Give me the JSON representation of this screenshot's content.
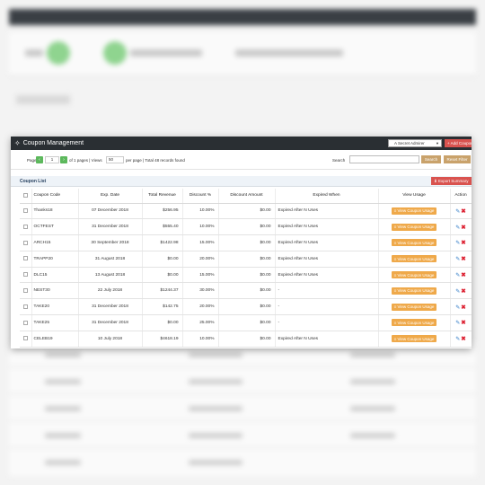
{
  "window": {
    "title": "Coupon Management",
    "admin_select": "A Secret Admirer",
    "add_button": "+ Add Coupon"
  },
  "pager": {
    "page_label": "Page",
    "current_page": "1",
    "of_pages_text": "of 1 pages | Views",
    "per_page_value": "50",
    "per_page_suffix": "per page | Total 48 records found",
    "search_label": "Search",
    "search_value": "",
    "search_button": "Search",
    "reset_button": "Reset Filter"
  },
  "list": {
    "title": "Coupon List",
    "export_button": "Export Summary"
  },
  "columns": [
    "Coupon Code",
    "Exp. Date",
    "Total Revenue",
    "Discount %",
    "Discount Amount",
    "Expired When",
    "View Usage",
    "Action"
  ],
  "rows": [
    {
      "code": "Thanks18",
      "date": "07 December 2018",
      "revenue": "$256.95",
      "discount": "10.00%",
      "amount": "$0.00",
      "expired": "Expired After N Uses",
      "usage": "View Coupon Usage"
    },
    {
      "code": "OCTFEST",
      "date": "31 December 2018",
      "revenue": "$555.40",
      "discount": "10.00%",
      "amount": "$0.00",
      "expired": "Expired After N Uses",
      "usage": "View Coupon Usage"
    },
    {
      "code": "ARCH15",
      "date": "30 September 2018",
      "revenue": "$1422.98",
      "discount": "15.00%",
      "amount": "$0.00",
      "expired": "Expired After N Uses",
      "usage": "View Coupon Usage"
    },
    {
      "code": "TRAPP20",
      "date": "31 August 2018",
      "revenue": "$0.00",
      "discount": "20.00%",
      "amount": "$0.00",
      "expired": "Expired After N Uses",
      "usage": "View Coupon Usage"
    },
    {
      "code": "DLC15",
      "date": "13 August 2018",
      "revenue": "$0.00",
      "discount": "15.00%",
      "amount": "$0.00",
      "expired": "Expired After N Uses",
      "usage": "View Coupon Usage"
    },
    {
      "code": "NEST30",
      "date": "22 July 2018",
      "revenue": "$1244.37",
      "discount": "30.00%",
      "amount": "$0.00",
      "expired": "-",
      "usage": "View Coupon Usage"
    },
    {
      "code": "TAKE20",
      "date": "31 December 2018",
      "revenue": "$142.75",
      "discount": "20.00%",
      "amount": "$0.00",
      "expired": "-",
      "usage": "View Coupon Usage"
    },
    {
      "code": "TAKE25",
      "date": "31 December 2018",
      "revenue": "$0.00",
      "discount": "25.00%",
      "amount": "$0.00",
      "expired": "-",
      "usage": "View Coupon Usage"
    },
    {
      "code": "CELEB19",
      "date": "10 July 2018",
      "revenue": "$4618.19",
      "discount": "10.00%",
      "amount": "$0.00",
      "expired": "Expired After N Uses",
      "usage": "View Coupon Usage"
    }
  ],
  "icons": {
    "edit": "edit-icon",
    "delete": "close-icon"
  }
}
